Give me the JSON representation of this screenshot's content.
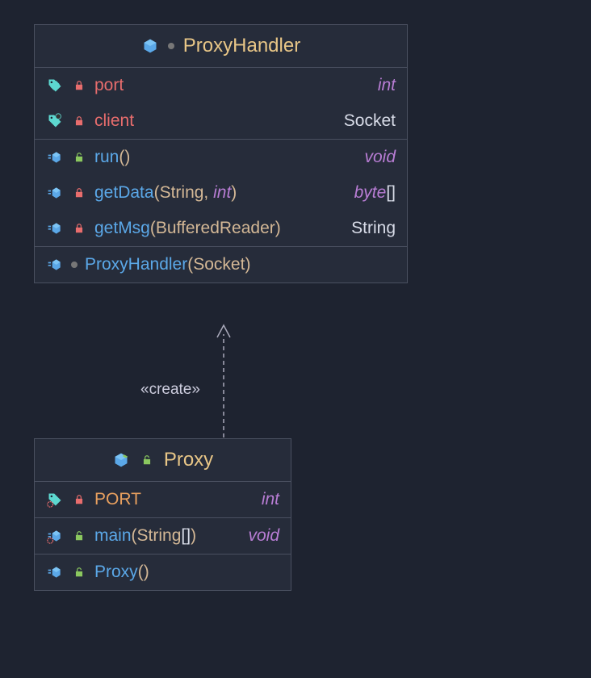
{
  "classes": {
    "proxyHandler": {
      "name": "ProxyHandler",
      "fields": [
        {
          "name": "port",
          "type": "int",
          "typeItalic": true,
          "visibility": "private"
        },
        {
          "name": "client",
          "type": "Socket",
          "typeItalic": false,
          "visibility": "private"
        }
      ],
      "methods": [
        {
          "name": "run",
          "params": [],
          "return": "void",
          "returnItalic": true,
          "visibility": "public"
        },
        {
          "name": "getData",
          "params": [
            {
              "t": "String",
              "it": false
            },
            {
              "t": "int",
              "it": true
            }
          ],
          "return": "byte[]",
          "returnItalic": false,
          "returnParts": [
            {
              "t": "byte",
              "it": true
            },
            {
              "t": "[]",
              "it": false
            }
          ],
          "visibility": "private"
        },
        {
          "name": "getMsg",
          "params": [
            {
              "t": "BufferedReader",
              "it": false
            }
          ],
          "return": "String",
          "returnItalic": false,
          "visibility": "private"
        }
      ],
      "constructors": [
        {
          "name": "ProxyHandler",
          "params": [
            {
              "t": "Socket",
              "it": false
            }
          ],
          "visibility": "package"
        }
      ]
    },
    "proxy": {
      "name": "Proxy",
      "fields": [
        {
          "name": "PORT",
          "type": "int",
          "typeItalic": true,
          "visibility": "private",
          "static": true
        }
      ],
      "methods": [
        {
          "name": "main",
          "params": [
            {
              "t": "String[]",
              "it": false,
              "parts": [
                {
                  "t": "String",
                  "c": "tan"
                },
                {
                  "t": "[]",
                  "c": "white"
                }
              ]
            }
          ],
          "return": "void",
          "returnItalic": true,
          "visibility": "public",
          "static": true
        }
      ],
      "constructors": [
        {
          "name": "Proxy",
          "params": [],
          "visibility": "public"
        }
      ]
    }
  },
  "connector": {
    "label": "«create»"
  },
  "punct": {
    "lparen": "(",
    "rparen": ")",
    "comma": ",",
    "lbrack": "[",
    "rbrack": "]"
  }
}
